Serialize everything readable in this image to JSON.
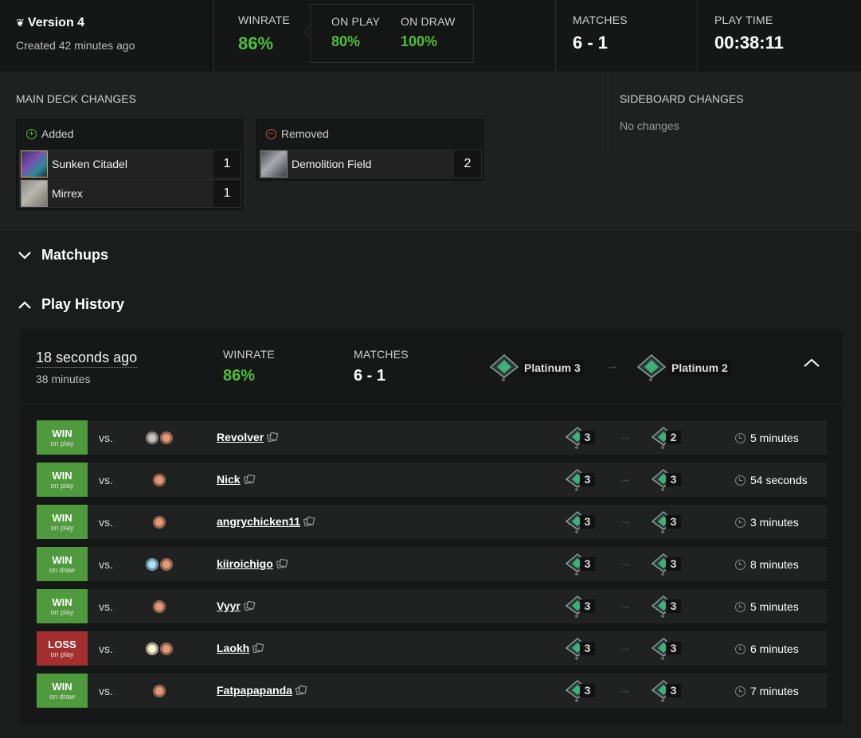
{
  "header": {
    "version_title": "Version 4",
    "created": "Created 42 minutes ago",
    "winrate_label": "WINRATE",
    "winrate": "86%",
    "on_play_label": "ON PLAY",
    "on_play": "80%",
    "on_draw_label": "ON DRAW",
    "on_draw": "100%",
    "matches_label": "MATCHES",
    "matches": "6 - 1",
    "playtime_label": "PLAY TIME",
    "playtime": "00:38:11"
  },
  "changes": {
    "main_title": "MAIN DECK CHANGES",
    "added_label": "Added",
    "removed_label": "Removed",
    "added": [
      {
        "name": "Sunken Citadel",
        "count": "1"
      },
      {
        "name": "Mirrex",
        "count": "1"
      }
    ],
    "removed": [
      {
        "name": "Demolition Field",
        "count": "2"
      }
    ],
    "side_title": "SIDEBOARD CHANGES",
    "side_none": "No changes"
  },
  "sections": {
    "matchups": "Matchups",
    "history": "Play History"
  },
  "session": {
    "time": "18 seconds ago",
    "duration": "38 minutes",
    "winrate_label": "WINRATE",
    "winrate": "86%",
    "matches_label": "MATCHES",
    "matches": "6 - 1",
    "rank_from": "Platinum 3",
    "rank_to": "Platinum 2"
  },
  "colors": {
    "win": "#4e9a3c",
    "loss": "#a3302f",
    "accent_green": "#4fbf3a",
    "red_mana": "#e49977",
    "blue_mana": "#aae0fa",
    "black_mana": "#cbc2bf",
    "white_mana": "#fffbd5"
  },
  "matches": [
    {
      "result": "WIN",
      "sub": "on play",
      "vs": "vs.",
      "mana": [
        "black",
        "red"
      ],
      "opponent": "Revolver",
      "rank_from": "3",
      "rank_to": "2",
      "duration": "5 minutes"
    },
    {
      "result": "WIN",
      "sub": "on play",
      "vs": "vs.",
      "mana": [
        "red"
      ],
      "opponent": "Nick",
      "rank_from": "3",
      "rank_to": "3",
      "duration": "54 seconds"
    },
    {
      "result": "WIN",
      "sub": "on play",
      "vs": "vs.",
      "mana": [
        "red"
      ],
      "opponent": "angrychicken11",
      "rank_from": "3",
      "rank_to": "3",
      "duration": "3 minutes"
    },
    {
      "result": "WIN",
      "sub": "on draw",
      "vs": "vs.",
      "mana": [
        "blue",
        "red"
      ],
      "opponent": "kiiroichigo",
      "rank_from": "3",
      "rank_to": "3",
      "duration": "8 minutes"
    },
    {
      "result": "WIN",
      "sub": "on play",
      "vs": "vs.",
      "mana": [
        "red"
      ],
      "opponent": "Vyyr",
      "rank_from": "3",
      "rank_to": "3",
      "duration": "5 minutes"
    },
    {
      "result": "LOSS",
      "sub": "on play",
      "vs": "vs.",
      "mana": [
        "white",
        "red"
      ],
      "opponent": "Laokh",
      "rank_from": "3",
      "rank_to": "3",
      "duration": "6 minutes"
    },
    {
      "result": "WIN",
      "sub": "on draw",
      "vs": "vs.",
      "mana": [
        "red"
      ],
      "opponent": "Fatpapapanda",
      "rank_from": "3",
      "rank_to": "3",
      "duration": "7 minutes"
    }
  ]
}
